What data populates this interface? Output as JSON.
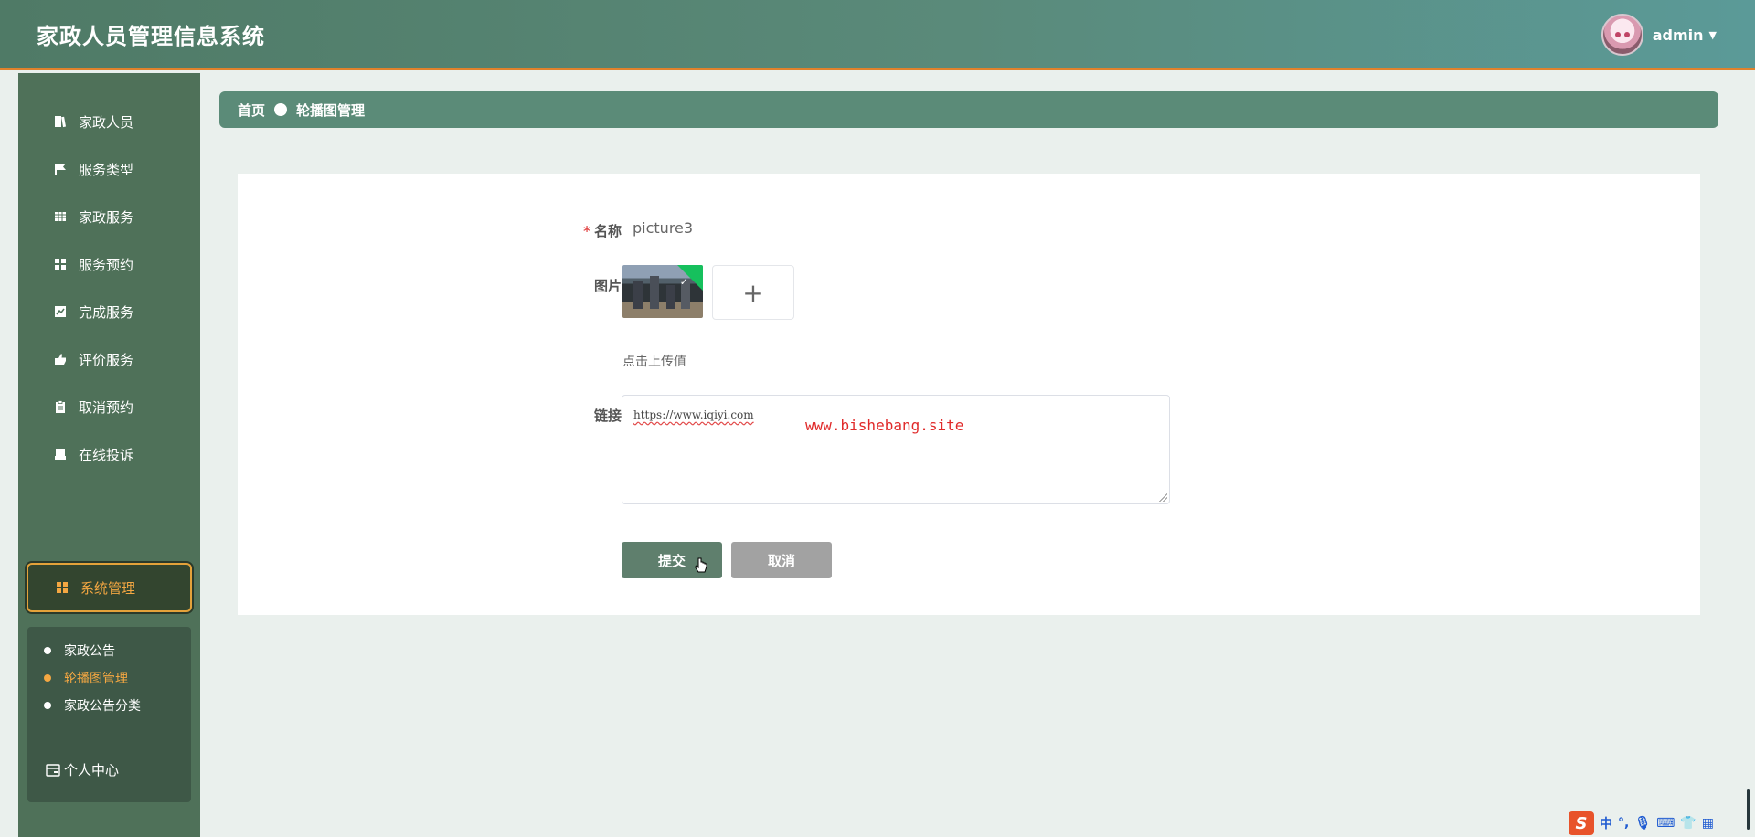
{
  "header": {
    "title": "家政人员管理信息系统",
    "username": "admin"
  },
  "sidebar": {
    "items": [
      {
        "label": "家政人员",
        "icon": "book-icon"
      },
      {
        "label": "服务类型",
        "icon": "flag-icon"
      },
      {
        "label": "家政服务",
        "icon": "table-icon"
      },
      {
        "label": "服务预约",
        "icon": "grid-icon"
      },
      {
        "label": "完成服务",
        "icon": "chart-icon"
      },
      {
        "label": "评价服务",
        "icon": "thumbs-up-icon"
      },
      {
        "label": "取消预约",
        "icon": "clipboard-icon"
      },
      {
        "label": "在线投诉",
        "icon": "print-icon"
      },
      {
        "label": "系统管理",
        "icon": "grid-icon",
        "active": true
      }
    ],
    "submenu": [
      {
        "label": "家政公告"
      },
      {
        "label": "轮播图管理",
        "active": true
      },
      {
        "label": "家政公告分类"
      }
    ],
    "personal": "个人中心"
  },
  "breadcrumb": {
    "home": "首页",
    "current": "轮播图管理"
  },
  "form": {
    "name_label": "名称",
    "name_value": "picture3",
    "image_label": "图片",
    "upload_tip": "点击上传值",
    "link_label": "链接",
    "link_value": "https://www.iqiyi.com",
    "watermark": "www.bishebang.site",
    "submit_label": "提交",
    "cancel_label": "取消"
  },
  "ime": {
    "logo": "S",
    "lang": "中"
  },
  "colors": {
    "header": "#5a8a7a",
    "sidebar": "#4f7159",
    "accent": "#f4a742",
    "breadcrumb": "#5b8b78",
    "submit": "#5f7f6d",
    "cancel": "#a2a2a2"
  }
}
